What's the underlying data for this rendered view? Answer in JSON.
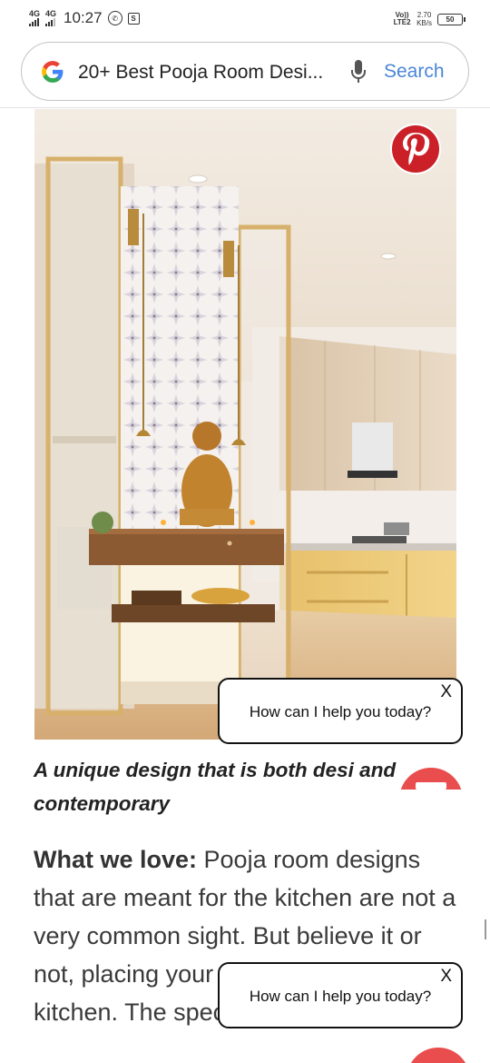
{
  "status_bar": {
    "network1": "4G",
    "network2": "4G",
    "time": "10:27",
    "volte": "Vo)) LTE2",
    "speed_value": "2.70",
    "speed_unit": "KB/s",
    "battery": "50"
  },
  "search": {
    "query": "20+ Best Pooja Room Desi...",
    "button_label": "Search",
    "logo_icon": "google-g-icon",
    "mic_icon": "microphone-icon"
  },
  "article": {
    "image_alt_icon": "pinterest-icon",
    "caption": "A unique design that is both desi and contemporary",
    "body_label": "What we love:",
    "body_text": " Pooja room designs that are meant for the kitchen are not a very common sight. But believe it or not, placing your pooja unit in the kitchen. The special thing about"
  },
  "chat_popups": [
    {
      "message": "How can I help you today?",
      "close": "X"
    },
    {
      "message": "How can I help you today?",
      "close": "X"
    }
  ],
  "colors": {
    "pinterest_red": "#cb2027",
    "search_blue": "#4a86d8",
    "fab_red": "#ea4d4d"
  }
}
